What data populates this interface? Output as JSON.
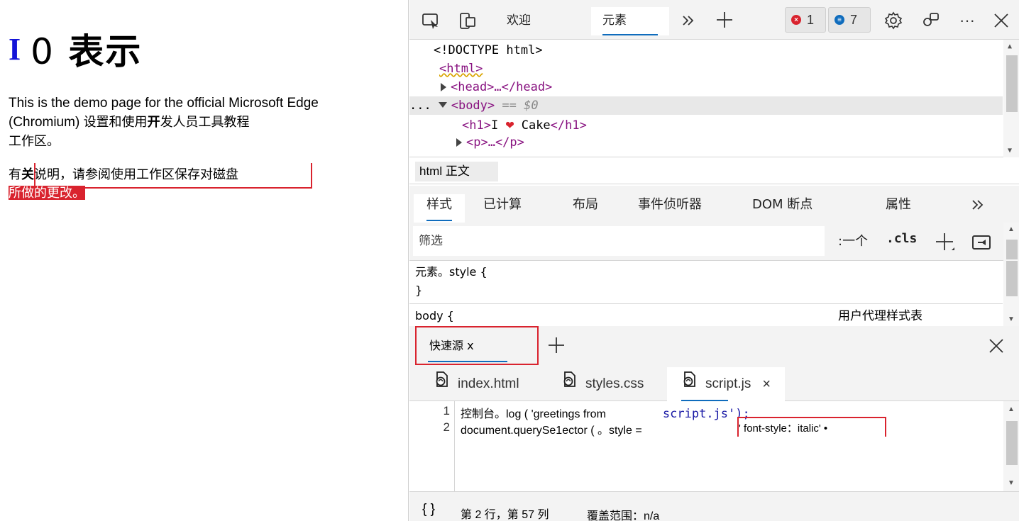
{
  "demo": {
    "heading_i": "I",
    "heading_zero": "0",
    "heading_rest": "表示",
    "intro_text": "This is the demo page for the official Microsoft Edge (Chromium) ",
    "intro_cjk_a": "设置和使用",
    "intro_bold": "开",
    "intro_cjk_b": "发人员工具教程",
    "intro_line3": "工作区。",
    "note_prefix": "有",
    "note_bold": "关",
    "note_rest": "说明，请参阅使用工作区保存对磁盘",
    "note_highlight": "所做的更改。"
  },
  "toolbar": {
    "tab_welcome": "欢迎",
    "tab_elements": "元素",
    "errors_count": "1",
    "messages_count": "7"
  },
  "dom": {
    "doctype": "<!DOCTYPE html>",
    "html_tag": "<html>",
    "head_line": "<head>…</head>",
    "body_dots": "...",
    "body_tag": "<body>",
    "body_eq": " == $0",
    "h1_open": "<h1>",
    "h1_text_a": "I ",
    "h1_text_b": " Cake",
    "h1_close": "</h1>",
    "p_line": "<p>…</p>"
  },
  "breadcrumb": {
    "html": "html",
    "body": "正文"
  },
  "styles_tabs": [
    "样式",
    "已计算",
    "布局",
    "事件侦听器",
    "DOM 断点",
    "属性"
  ],
  "filter": {
    "placeholder": "筛选",
    "hov": ":一个",
    "cls": ".cls"
  },
  "rules": {
    "element_style": "元素。style {",
    "close_brace": "}",
    "body_rule": "body {",
    "ua": "用户代理样式表"
  },
  "quick_source": {
    "tab_label": "快速源 x"
  },
  "files": [
    "index.html",
    "styles.css",
    "script.js"
  ],
  "file_close": "×",
  "code": {
    "line1_num": "1",
    "line1_a": "控制台。log ( 'greetings from",
    "line1_b": "script.js');",
    "line2_num": "2",
    "line2_a": "document.querySe1ector ( 。style =",
    "line2_b": "' font-style：italic' •"
  },
  "status": {
    "braces": "{ }",
    "position": "第 2 行，第 57 列",
    "coverage": "覆盖范围：n/a"
  },
  "colors": {
    "accent": "#0f6cbd",
    "annotation_red": "#d9232e",
    "tag_purple": "#881280"
  }
}
